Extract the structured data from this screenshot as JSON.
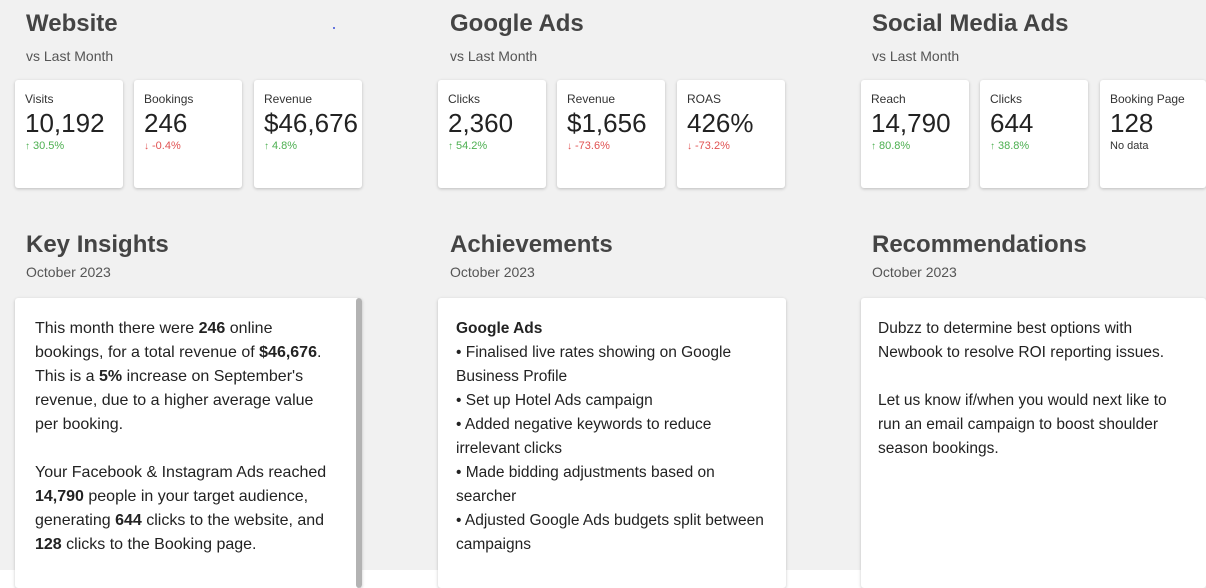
{
  "website": {
    "title": "Website",
    "subtitle": "vs Last Month",
    "cards": [
      {
        "label": "Visits",
        "value": "10,192",
        "delta": "30.5%",
        "dir": "up"
      },
      {
        "label": "Bookings",
        "value": "246",
        "delta": "-0.4%",
        "dir": "down"
      },
      {
        "label": "Revenue",
        "value": "$46,676",
        "delta": "4.8%",
        "dir": "up"
      }
    ]
  },
  "google_ads": {
    "title": "Google Ads",
    "subtitle": "vs Last Month",
    "cards": [
      {
        "label": "Clicks",
        "value": "2,360",
        "delta": "54.2%",
        "dir": "up"
      },
      {
        "label": "Revenue",
        "value": "$1,656",
        "delta": "-73.6%",
        "dir": "down"
      },
      {
        "label": "ROAS",
        "value": "426%",
        "delta": "-73.2%",
        "dir": "down"
      }
    ]
  },
  "social_ads": {
    "title": "Social Media Ads",
    "subtitle": "vs Last Month",
    "cards": [
      {
        "label": "Reach",
        "value": "14,790",
        "delta": "80.8%",
        "dir": "up"
      },
      {
        "label": "Clicks",
        "value": "644",
        "delta": "38.8%",
        "dir": "up"
      },
      {
        "label": "Booking Page",
        "value": "128",
        "delta": "No data",
        "dir": "neutral"
      }
    ]
  },
  "insights": {
    "title": "Key Insights",
    "subtitle": "October 2023",
    "p1": [
      "This month there were ",
      "246",
      " online bookings, for a total revenue of ",
      "$46,676",
      ". This is a ",
      "5%",
      " increase on September's revenue, due to a higher average value per booking."
    ],
    "p2": [
      "Your Facebook & Instagram Ads reached ",
      "14,790",
      " people in your target audience, generating ",
      "644",
      " clicks to the website, and ",
      "128",
      " clicks to the Booking page."
    ]
  },
  "achievements": {
    "title": "Achievements",
    "subtitle": "October 2023",
    "heading": "Google Ads",
    "items": [
      "• Finalised live rates showing on Google Business Profile",
      "• Set up Hotel Ads campaign",
      "• Added negative keywords to reduce irrelevant clicks",
      "• Made bidding adjustments based on searcher",
      "• Adjusted Google Ads budgets split between campaigns"
    ]
  },
  "recommendations": {
    "title": "Recommendations",
    "subtitle": "October 2023",
    "p1": "Dubzz to determine best options with Newbook to resolve ROI reporting issues.",
    "p2": "Let us know if/when you would next like to run an email campaign to boost shoulder season bookings."
  }
}
